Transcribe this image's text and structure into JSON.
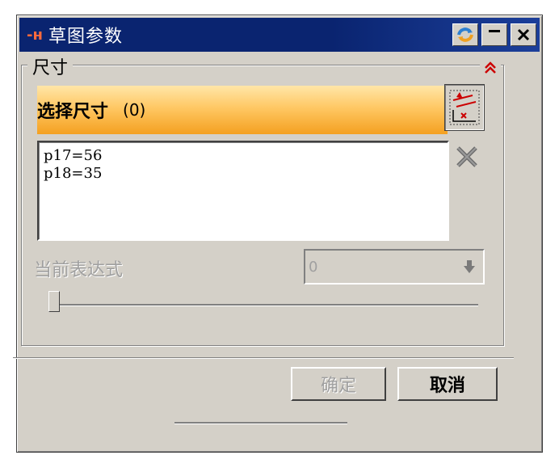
{
  "window": {
    "title": "草图参数",
    "app_icon": "nx-logo-icon",
    "controls": [
      "refresh-icon",
      "minimize-icon",
      "close-icon"
    ]
  },
  "dimensions_group": {
    "title": "尺寸",
    "collapse_icon": "chevron-double-up-icon",
    "select_label": "选择尺寸",
    "select_count": "(0)",
    "items": [
      "p17=56",
      "p18=35"
    ]
  },
  "expression": {
    "label": "当前表达式",
    "value": "0"
  },
  "buttons": {
    "ok_label": "确定",
    "cancel_label": "取消"
  },
  "colors": {
    "title_bar": "#0a2470",
    "select_bar": "#ffc864",
    "accent_red": "#cc0000"
  }
}
